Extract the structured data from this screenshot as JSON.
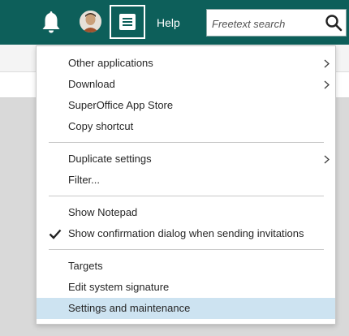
{
  "header": {
    "help_label": "Help",
    "search": {
      "placeholder": "Freetext search",
      "value": ""
    },
    "icons": [
      "bell-icon",
      "avatar",
      "menu-icon",
      "search-icon"
    ]
  },
  "menu": {
    "items": [
      {
        "label": "Other applications",
        "has_submenu": true
      },
      {
        "label": "Download",
        "has_submenu": true
      },
      {
        "label": "SuperOffice App Store"
      },
      {
        "label": "Copy shortcut"
      },
      {
        "label": "Duplicate settings",
        "has_submenu": true
      },
      {
        "label": "Filter..."
      },
      {
        "label": "Show Notepad"
      },
      {
        "label": "Show confirmation dialog when sending invitations",
        "checked": true
      },
      {
        "label": "Targets"
      },
      {
        "label": "Edit system signature"
      },
      {
        "label": "Settings and maintenance",
        "highlighted": true
      }
    ]
  },
  "colors": {
    "header_bg": "#0d5f5a",
    "highlight_bg": "#cde3f1",
    "text": "#262626"
  }
}
